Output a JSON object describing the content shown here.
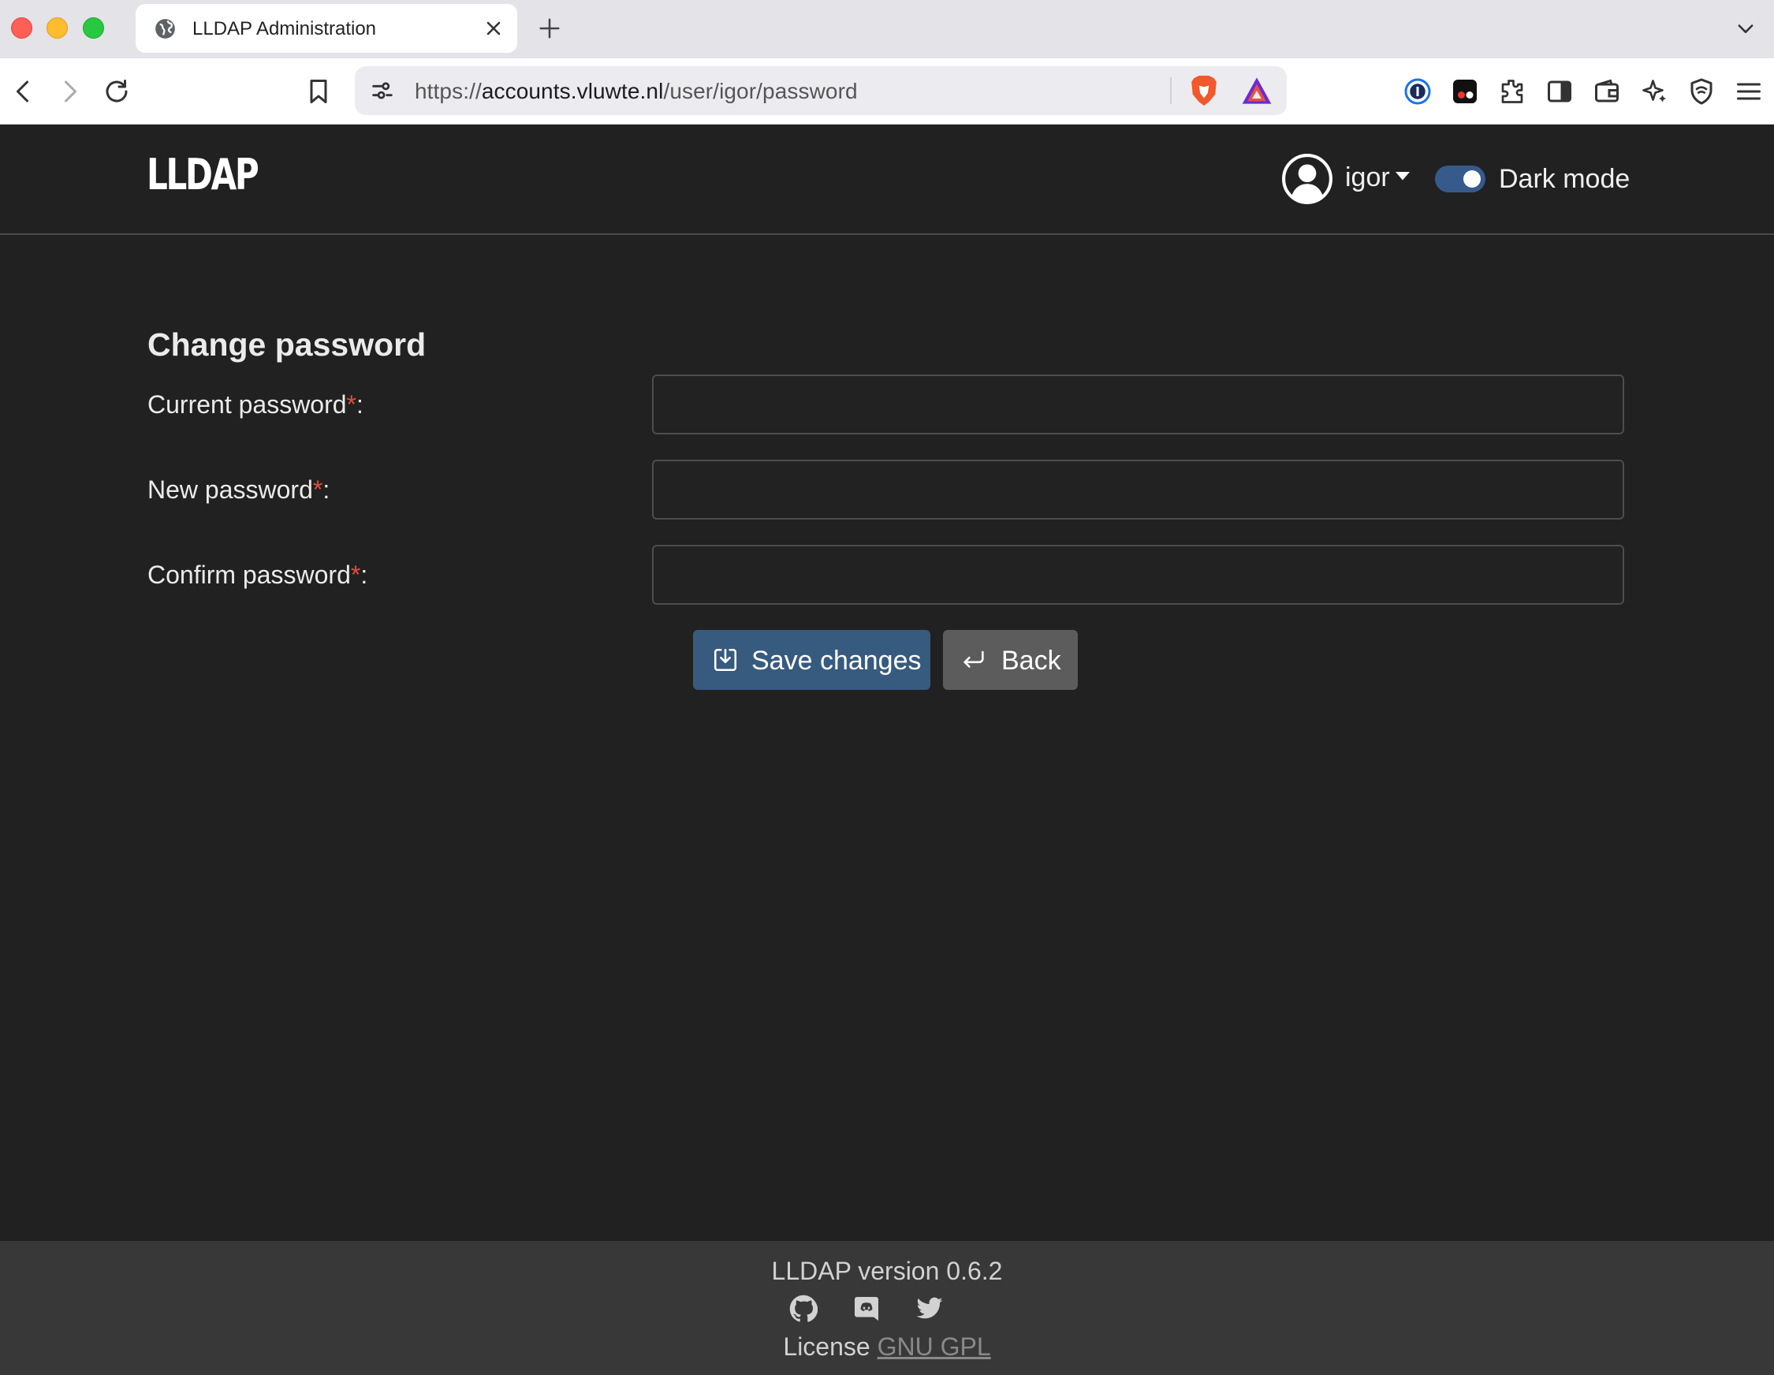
{
  "browser": {
    "tab_title": "LLDAP Administration",
    "url_scheme": "https://",
    "url_host": "accounts.vluwte.nl",
    "url_path": "/user/igor/password"
  },
  "header": {
    "logo": "LLDAP",
    "username": "igor",
    "dark_mode_label": "Dark mode",
    "dark_mode_on": true
  },
  "form": {
    "title": "Change password",
    "fields": [
      {
        "label": "Current password",
        "required_mark": "*",
        "suffix": ":",
        "value": ""
      },
      {
        "label": "New password",
        "required_mark": "*",
        "suffix": ":",
        "value": ""
      },
      {
        "label": "Confirm password",
        "required_mark": "*",
        "suffix": ":",
        "value": ""
      }
    ],
    "save_label": "Save changes",
    "back_label": "Back"
  },
  "footer": {
    "version": "LLDAP version 0.6.2",
    "license_prefix": "License",
    "license_link": "GNU GPL",
    "social_icons": [
      "github-icon",
      "discord-icon",
      "twitter-icon"
    ]
  },
  "colors": {
    "background": "#212121",
    "primary": "#375a7f",
    "secondary": "#5c5c5c",
    "required": "#e74c3c",
    "footer": "#383838"
  }
}
